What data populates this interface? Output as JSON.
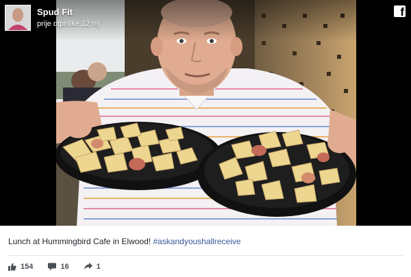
{
  "post": {
    "page_name": "Spud Fit",
    "timestamp": "prije otprilike 12 mj",
    "caption": "Lunch at Hummingbird Cafe in Elwood! ",
    "hashtag": "#askandyoushallreceive",
    "colors": {
      "hashtag": "#365899",
      "text": "#1d2129",
      "stats": "#4b4f56"
    }
  },
  "stats": {
    "likes": "154",
    "comments": "16",
    "shares": "1"
  },
  "icons": [
    "facebook-icon",
    "like-icon",
    "comment-icon",
    "share-icon"
  ]
}
